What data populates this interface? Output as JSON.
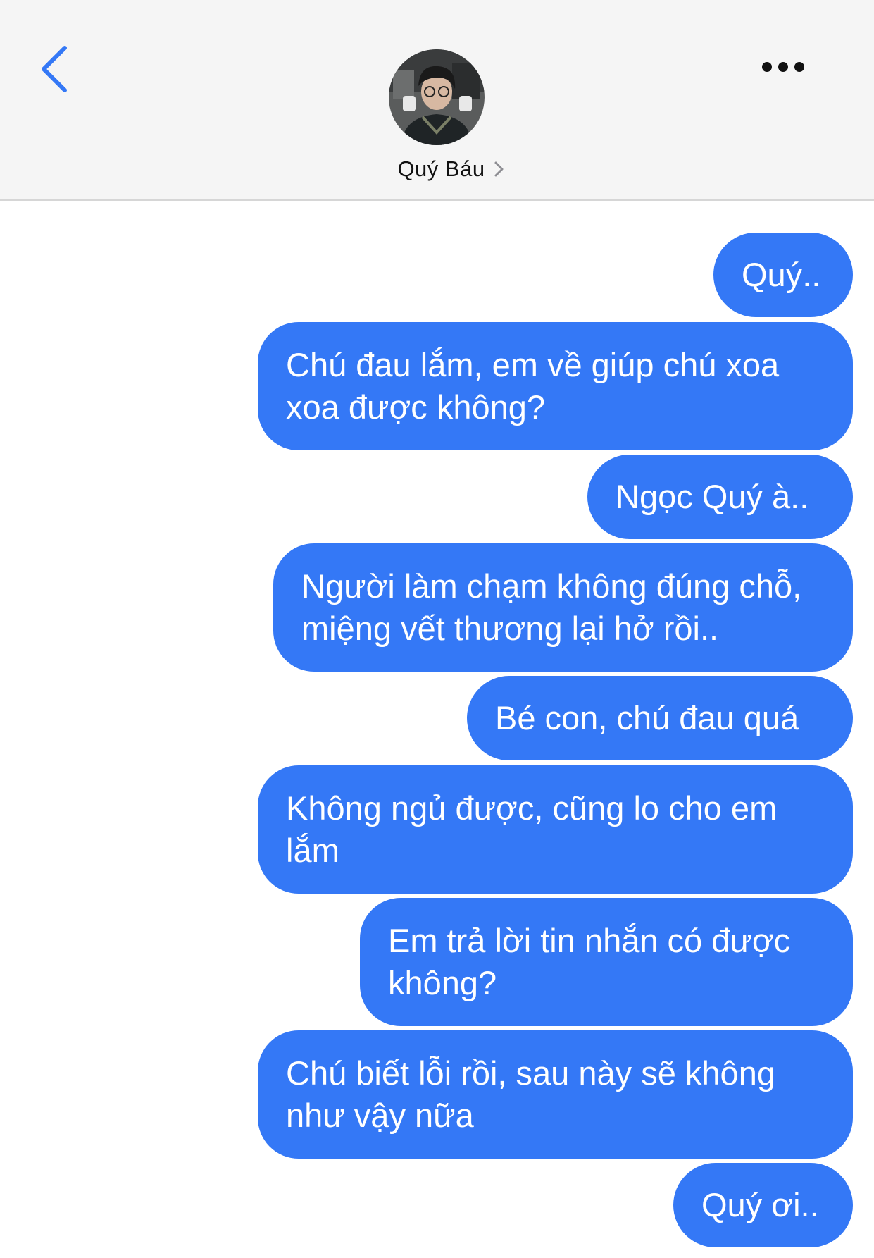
{
  "header": {
    "contact_name": "Quý Báu"
  },
  "messages": [
    {
      "text": "Quý.."
    },
    {
      "text": "Chú đau lắm, em về giúp chú xoa xoa được không?"
    },
    {
      "text": "Ngọc Quý à.."
    },
    {
      "text": "Người làm chạm không đúng chỗ, miệng vết thương lại hở rồi.."
    },
    {
      "text": "Bé con, chú đau quá"
    },
    {
      "text": "Không ngủ được, cũng lo cho em lắm"
    },
    {
      "text": "Em trả lời tin nhắn có được không?"
    },
    {
      "text": "Chú biết lỗi rồi, sau này sẽ không như vậy nữa"
    },
    {
      "text": "Quý ơi.."
    }
  ],
  "colors": {
    "bubble": "#3478f6",
    "accent": "#3478f6",
    "header_bg": "#f5f5f5"
  },
  "icons": {
    "back": "chevron-left-icon",
    "more": "ellipsis-icon",
    "name_chevron": "chevron-right-icon"
  }
}
